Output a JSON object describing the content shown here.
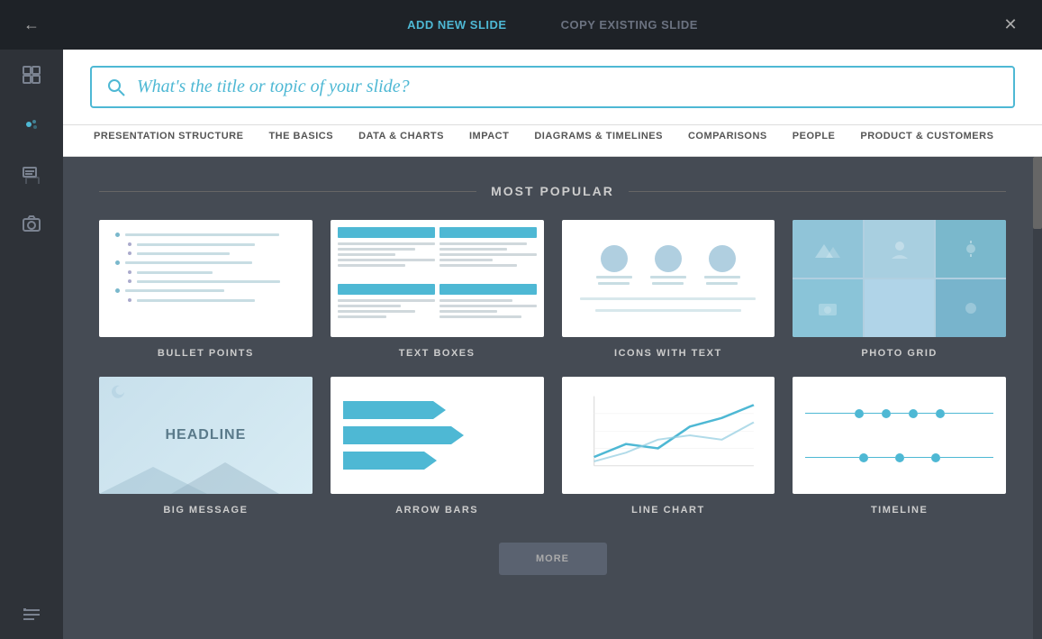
{
  "header": {
    "tab_add": "ADD NEW SLIDE",
    "tab_copy": "COPY EXISTING SLIDE",
    "close_label": "✕"
  },
  "search": {
    "placeholder": "What's the title or topic of your slide?"
  },
  "nav_tabs": [
    {
      "id": "presentation-structure",
      "label": "PRESENTATION STRUCTURE"
    },
    {
      "id": "the-basics",
      "label": "THE BASICS"
    },
    {
      "id": "data-charts",
      "label": "DATA & CHARTS"
    },
    {
      "id": "impact",
      "label": "IMPACT"
    },
    {
      "id": "diagrams-timelines",
      "label": "DIAGRAMS & TIMELINES"
    },
    {
      "id": "comparisons",
      "label": "COMPARISONS"
    },
    {
      "id": "people",
      "label": "PEOPLE"
    },
    {
      "id": "product-customers",
      "label": "PRODUCT & CUSTOMERS"
    }
  ],
  "section": {
    "most_popular": "MOST POPULAR"
  },
  "slides": [
    {
      "id": "bullet-points",
      "label": "BULLET POINTS"
    },
    {
      "id": "text-boxes",
      "label": "TEXT BOXES"
    },
    {
      "id": "icons-with-text",
      "label": "ICONS WITH TEXT"
    },
    {
      "id": "photo-grid",
      "label": "PHOTO GRID"
    },
    {
      "id": "big-message",
      "label": "BIG MESSAGE"
    },
    {
      "id": "arrow-bars",
      "label": "ARROW BARS"
    },
    {
      "id": "line-chart",
      "label": "LINE CHART"
    },
    {
      "id": "timeline",
      "label": "TIMELINE"
    }
  ],
  "sidebar_icons": [
    {
      "id": "back",
      "label": "←"
    },
    {
      "id": "grid",
      "label": "⊞"
    },
    {
      "id": "dots",
      "label": "✦"
    },
    {
      "id": "slides",
      "label": "▤"
    },
    {
      "id": "camera",
      "label": "⊙"
    },
    {
      "id": "list",
      "label": "☰"
    }
  ],
  "big_message_text": "HEADLINE"
}
